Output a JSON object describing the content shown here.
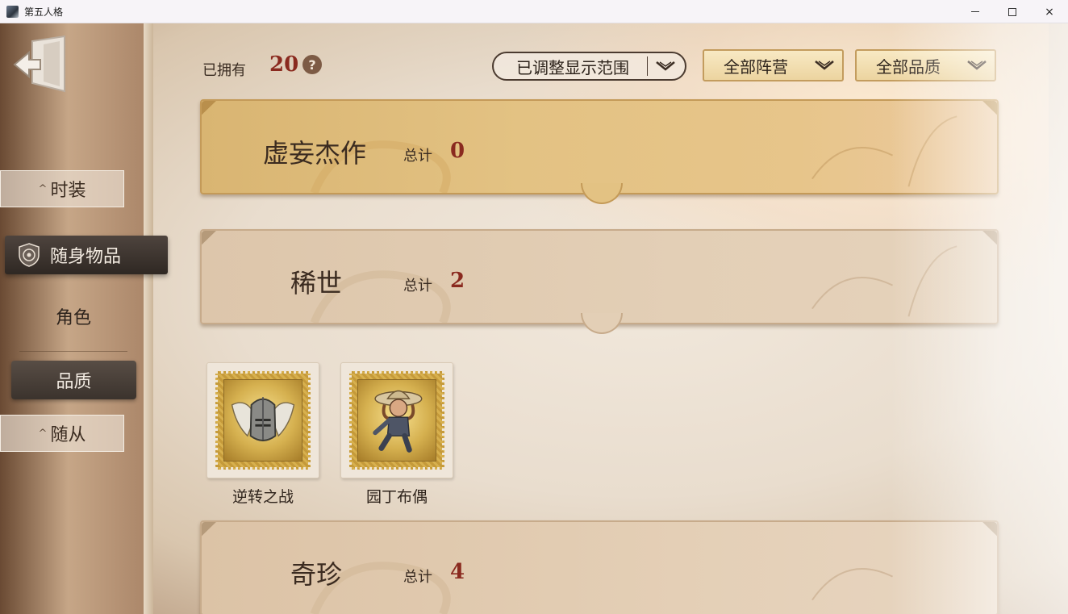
{
  "window": {
    "title": "第五人格",
    "icon": "app-icon",
    "controls": {
      "minimize": "minimize-icon",
      "maximize": "maximize-icon",
      "close": "×"
    }
  },
  "sidebar": {
    "back_icon": "exit-door-icon",
    "tabs": [
      {
        "label": "时装",
        "state": "collapsed"
      },
      {
        "label": "随身物品",
        "state": "selected",
        "icon": "emblem-icon"
      },
      {
        "label": "角色",
        "state": "normal"
      },
      {
        "label": "品质",
        "state": "selected-sub"
      },
      {
        "label": "随从",
        "state": "collapsed"
      }
    ],
    "caret": "^"
  },
  "header": {
    "owned_label": "已拥有",
    "owned_count": "20",
    "help": "?",
    "range_filter": "已调整显示范围",
    "camp_filter": "全部阵营",
    "quality_filter": "全部品质"
  },
  "categories": [
    {
      "name": "虚妄杰作",
      "total_label": "总计",
      "total": "0",
      "color": "#e3c283"
    },
    {
      "name": "稀世",
      "total_label": "总计",
      "total": "2",
      "color": "#e3cfb6"
    },
    {
      "name": "奇珍",
      "total_label": "总计",
      "total": "4",
      "color": "#e4cfb6"
    }
  ],
  "items": [
    {
      "name": "逆转之战",
      "icon": "winged-helmet-icon"
    },
    {
      "name": "园丁布偶",
      "icon": "gardener-doll-icon"
    }
  ],
  "colors": {
    "accent_red": "#8a2a1f",
    "gold": "#d9b572",
    "dark_tab": "#3b332d"
  }
}
